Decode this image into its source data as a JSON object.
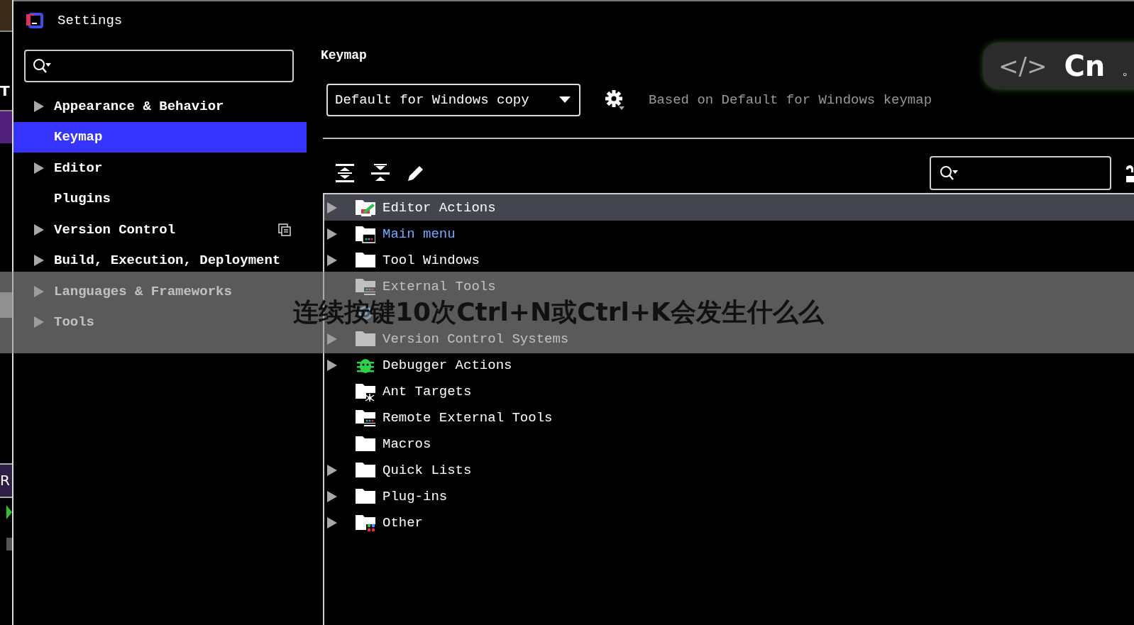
{
  "background_window": {
    "texts": [
      "T",
      "R"
    ]
  },
  "window": {
    "title": "Settings"
  },
  "sidebar": {
    "items": [
      {
        "label": "Appearance & Behavior",
        "expandable": true,
        "selected": false
      },
      {
        "label": "Keymap",
        "expandable": false,
        "selected": true
      },
      {
        "label": "Editor",
        "expandable": true,
        "selected": false
      },
      {
        "label": "Plugins",
        "expandable": false,
        "selected": false
      },
      {
        "label": "Version Control",
        "expandable": true,
        "selected": false,
        "project_icon": true
      },
      {
        "label": "Build, Execution, Deployment",
        "expandable": true,
        "selected": false
      },
      {
        "label": "Languages & Frameworks",
        "expandable": true,
        "selected": false
      },
      {
        "label": "Tools",
        "expandable": true,
        "selected": false
      }
    ]
  },
  "panel": {
    "heading": "Keymap",
    "keymap_select": "Default for Windows copy",
    "based_on": "Based on Default for Windows keymap",
    "tree": [
      {
        "label": "Editor Actions",
        "kind": "editor",
        "expandable": true,
        "selected": true,
        "modified": false
      },
      {
        "label": "Main menu",
        "kind": "menu",
        "expandable": true,
        "selected": false,
        "modified": true
      },
      {
        "label": "Tool Windows",
        "kind": "folder",
        "expandable": true,
        "selected": false,
        "modified": false
      },
      {
        "label": "External Tools",
        "kind": "tools",
        "expandable": false,
        "selected": false,
        "modified": false
      },
      {
        "kind": "gear",
        "expandable": false,
        "selected": false
      },
      {
        "label": "Version Control Systems",
        "kind": "folder",
        "expandable": true,
        "selected": false,
        "modified": false
      },
      {
        "label": "Debugger Actions",
        "kind": "bug",
        "expandable": true,
        "selected": false,
        "modified": false
      },
      {
        "label": "Ant Targets",
        "kind": "ant",
        "expandable": false,
        "selected": false,
        "modified": false
      },
      {
        "label": "Remote External Tools",
        "kind": "tools",
        "expandable": false,
        "selected": false,
        "modified": false
      },
      {
        "label": "Macros",
        "kind": "folder",
        "expandable": false,
        "selected": false,
        "modified": false
      },
      {
        "label": "Quick Lists",
        "kind": "folder",
        "expandable": true,
        "selected": false,
        "modified": false
      },
      {
        "label": "Plug-ins",
        "kind": "folder",
        "expandable": true,
        "selected": false,
        "modified": false
      },
      {
        "label": "Other",
        "kind": "other",
        "expandable": true,
        "selected": false,
        "modified": false
      }
    ]
  },
  "ime_indicator": {
    "mode_symbol": "</>",
    "language": "Cn",
    "punctuation": "。"
  },
  "caption_banner": {
    "text": "连续按键10次Ctrl+N或Ctrl+K会发生什么么"
  }
}
